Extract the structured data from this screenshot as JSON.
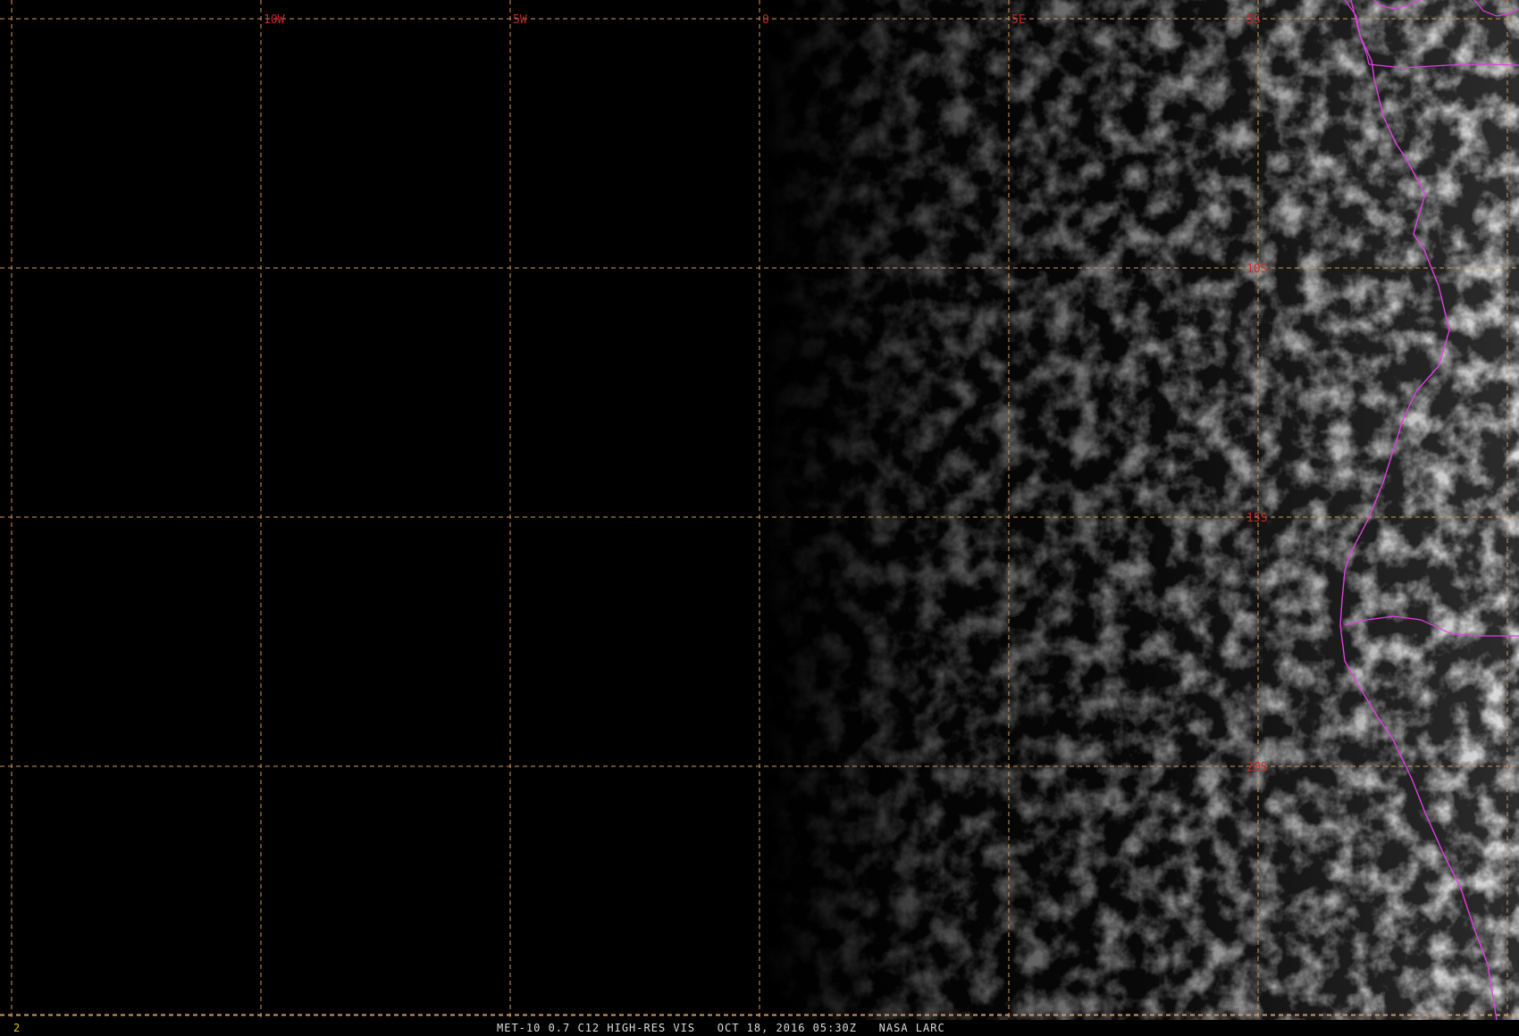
{
  "map": {
    "longitude_labels": [
      {
        "value": -10,
        "text": "10W"
      },
      {
        "value": -5,
        "text": "5W"
      },
      {
        "value": 0,
        "text": "0"
      },
      {
        "value": 5,
        "text": "5E"
      }
    ],
    "latitude_labels": [
      {
        "value": -5,
        "text": "5S"
      },
      {
        "value": -10,
        "text": "10S"
      },
      {
        "value": -15,
        "text": "15S"
      },
      {
        "value": -20,
        "text": "20S"
      }
    ],
    "colors": {
      "background": "#000000",
      "graticule": "#d4985a",
      "grid_label": "#c62828",
      "coastline": "#e040e0",
      "cloud": "#bdbdbd"
    }
  },
  "status_bar": {
    "frame_number": "2",
    "caption": "MET-10 0.7 C12 HIGH-RES VIS   OCT 18, 2016 05:30Z   NASA LARC"
  }
}
